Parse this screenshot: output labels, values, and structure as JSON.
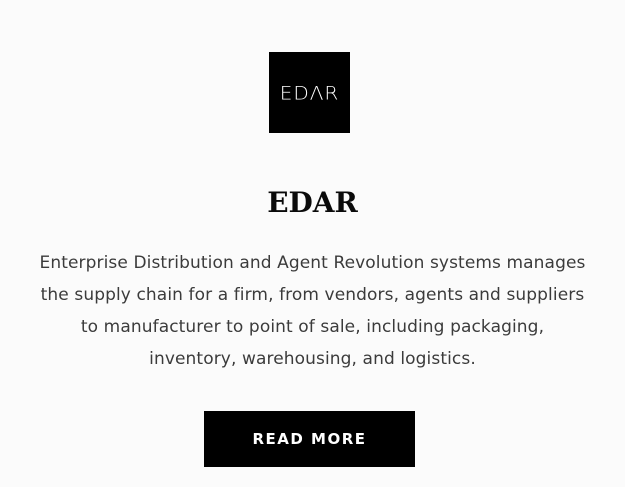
{
  "product": {
    "logo_text": "EDΛR",
    "title": "EDAR",
    "description": "Enterprise Distribution and Agent Revolution systems manages the supply chain for a firm, from vendors, agents and suppliers to manufacturer to point of sale, including packaging, inventory, warehousing, and logistics.",
    "read_more_label": "READ MORE"
  },
  "colors": {
    "background": "#fbfbfb",
    "logo_background": "#000000",
    "button_background": "#000000",
    "button_text": "#ffffff"
  }
}
